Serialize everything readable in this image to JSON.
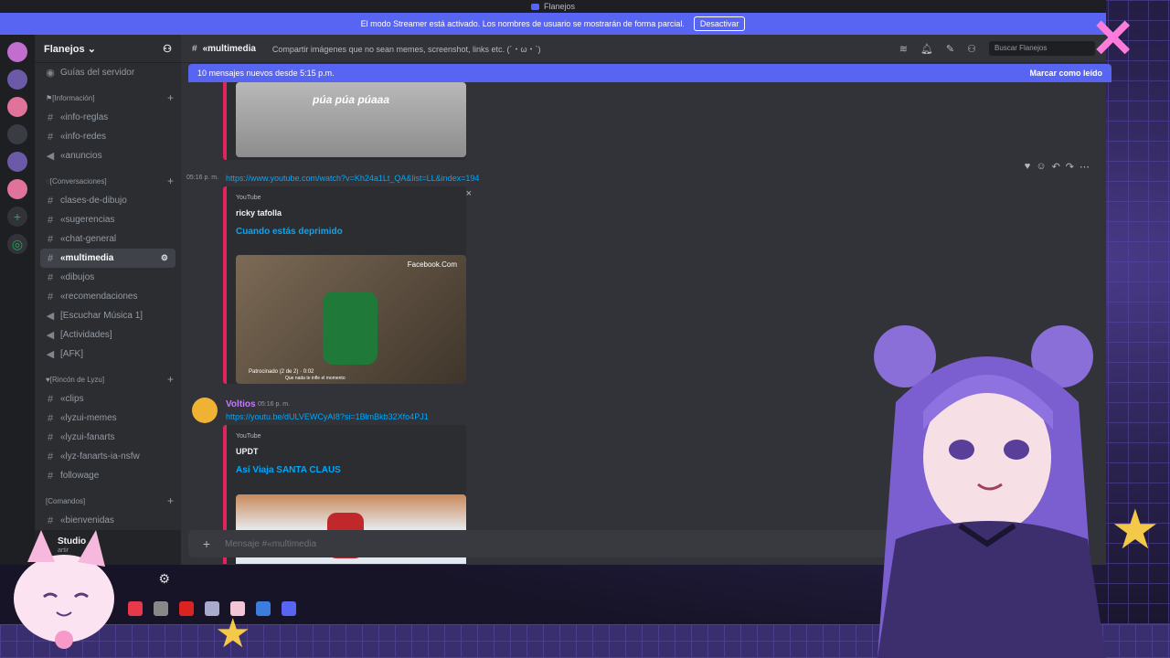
{
  "window": {
    "title": "Flanejos"
  },
  "streamer_bar": {
    "text": "El modo Streamer está activado. Los nombres de usuario se mostrarán de forma parcial.",
    "button": "Desactivar"
  },
  "guild": {
    "name": "Flanejos",
    "explore": "Guías del servidor"
  },
  "categories": [
    {
      "label": "[Información]",
      "channels": [
        {
          "name": "«info-reglas",
          "icon": "rules-icon"
        },
        {
          "name": "«info-redes",
          "icon": "rules-icon"
        },
        {
          "name": "«anuncios",
          "icon": "megaphone-icon"
        }
      ]
    },
    {
      "label": "[Conversaciones]",
      "channels": [
        {
          "name": "clases-de-dibujo",
          "icon": "hash-icon"
        },
        {
          "name": "«sugerencias",
          "icon": "hash-icon"
        },
        {
          "name": "«chat-general",
          "icon": "hash-icon"
        },
        {
          "name": "«multimedia",
          "icon": "hash-icon",
          "active": true
        },
        {
          "name": "«dibujos",
          "icon": "hash-icon"
        },
        {
          "name": "«recomendaciones",
          "icon": "hash-icon"
        },
        {
          "name": "[Escuchar Música 1]",
          "icon": "speaker-icon"
        },
        {
          "name": "[Actividades]",
          "icon": "speaker-icon"
        },
        {
          "name": "[AFK]",
          "icon": "speaker-icon"
        }
      ]
    },
    {
      "label": "[Rincón de Lyzu]",
      "channels": [
        {
          "name": "«clips",
          "icon": "hash-icon"
        },
        {
          "name": "«lyzui-memes",
          "icon": "hash-icon"
        },
        {
          "name": "«lyzui-fanarts",
          "icon": "hash-icon"
        },
        {
          "name": "«lyz-fanarts-ia-nsfw",
          "icon": "hash-icon"
        },
        {
          "name": "followage",
          "icon": "hash-icon"
        }
      ]
    },
    {
      "label": "[Comandos]",
      "channels": [
        {
          "name": "«bienvenidas",
          "icon": "hash-icon"
        }
      ]
    }
  ],
  "user_panel": {
    "name": "Studio",
    "status": "artir"
  },
  "topbar": {
    "channel": "«multimedia",
    "topic": "Compartir imágenes que no sean memes, screenshot, links etc. (´・ω・`)",
    "search_placeholder": "Buscar Flanejos"
  },
  "new_messages": {
    "text": "10 mensajes nuevos desde 5:15 p.m.",
    "action": "Marcar como leído"
  },
  "messages": {
    "first_embed_caption": "púa púa púaaa",
    "msg1": {
      "time": "05:16 p. m.",
      "link": "https://www.youtube.com/watch?v=Kh24a1Lt_QA&list=LL&index=194",
      "provider": "YouTube",
      "author": "ricky tafolla",
      "title": "Cuando estás deprimido",
      "thumb_brand": "Facebook.Com",
      "thumb_caption": "Patrocinado (2 de 2) · 0:02",
      "thumb_sub": "Que nada te infle el momento"
    },
    "msg2": {
      "user": "Voltios",
      "time": "05:16 p. m.",
      "link": "https://youtu.be/dULVEWCyAI8?si=1BlmBkb32Xfo4PJ1",
      "provider": "YouTube",
      "author": "UPDT",
      "title": "Así Viaja SANTA CLAUS"
    }
  },
  "composer": {
    "placeholder": "Mensaje #«multimedia"
  },
  "colors": {
    "accent": "#5865f2",
    "link": "#00a8fc",
    "embed_border": "#e0245e",
    "username": "#c27cf5"
  }
}
